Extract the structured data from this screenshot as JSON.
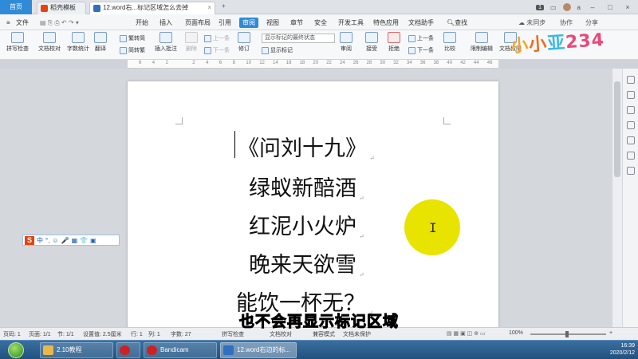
{
  "titlebar": {
    "home_tab": "首页",
    "tabs": [
      {
        "label": "稻壳模板",
        "icon": "daoke-icon"
      },
      {
        "label": "12.word右...标记区域怎么去掉",
        "icon": "word-doc-icon"
      }
    ],
    "add_tab": "+",
    "badge": "1",
    "user": "a"
  },
  "menu": {
    "file": "文件",
    "items": [
      "开始",
      "插入",
      "页面布局",
      "引用",
      "审阅",
      "视图",
      "章节",
      "安全",
      "开发工具",
      "特色应用",
      "文档助手"
    ],
    "active": "审阅",
    "search": "查找",
    "right": [
      "未同步",
      "协作",
      "分享"
    ]
  },
  "ribbon": {
    "spell_check": "拼写检查",
    "doc_proof": "文档校对",
    "word_count": "字数统计",
    "translate": "翻译",
    "trad_to_simp": "繁转简",
    "simp_to_trad": "简转繁",
    "insert_comment": "插入批注",
    "delete": "删除",
    "prev_comment": "上一条",
    "next_comment": "下一条",
    "track_changes": "修订",
    "markup_select": "显示标记的最终状态",
    "show_markup": "显示标记",
    "reviewer": "审阅",
    "accept": "接受",
    "reject": "拒绝",
    "prev_change": "上一条",
    "next_change": "下一条",
    "compare": "比较",
    "restrict_edit": "限制编辑",
    "doc_permission": "文档权限"
  },
  "ruler": {
    "ticks": [
      "6",
      "4",
      "2",
      "",
      "2",
      "4",
      "6",
      "8",
      "10",
      "12",
      "14",
      "16",
      "18",
      "20",
      "22",
      "24",
      "26",
      "28",
      "30",
      "32",
      "34",
      "36",
      "38",
      "40",
      "42",
      "44",
      "46"
    ]
  },
  "document": {
    "lines": [
      "《问刘十九》",
      "绿蚁新醅酒",
      "红泥小火炉",
      "晚来天欲雪",
      "能饮一杯无？"
    ],
    "para_mark": "↵",
    "cursor_glyph": "I"
  },
  "ime": {
    "logo": "S",
    "label": "中",
    "items": [
      "°,",
      "☺",
      "🎤",
      "▦",
      "👕",
      "▣"
    ]
  },
  "statusbar": {
    "page_no": "页码: 1",
    "pages": "页面: 1/1",
    "section": "节: 1/1",
    "setting": "设置值: 2.5厘米",
    "row": "行: 1",
    "col": "列: 1",
    "words": "字数: 27",
    "spell": "拼写检查",
    "proof": "文档校对",
    "compat": "兼容模式",
    "protect": "文档未保护",
    "zoom": "100%"
  },
  "subtitle": "也不会再显示标记区域",
  "taskbar": {
    "items": [
      {
        "label": "2.10教程",
        "color": "#e8b84a"
      },
      {
        "label": "",
        "color": "#cc2222"
      },
      {
        "label": "Bandicam",
        "color": "#cc2222"
      },
      {
        "label": "12.word右边的标...",
        "color": "#2f6fc0"
      }
    ],
    "time": "16:39",
    "date": "2020/2/12"
  },
  "watermark": {
    "logo_text": "小小亚234"
  }
}
